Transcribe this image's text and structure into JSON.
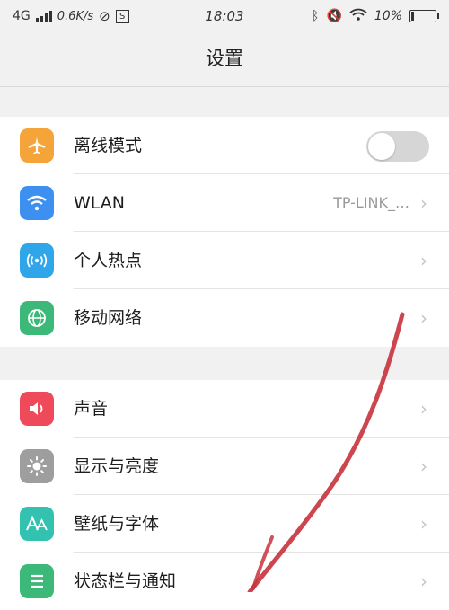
{
  "status_bar": {
    "network": "4G",
    "speed": "0.6K/s",
    "extra_box": "S",
    "time": "18:03",
    "battery": "10%",
    "battery_level": 0.1,
    "icons": [
      "signal-icon",
      "sync-icon",
      "bluetooth-icon",
      "mute-icon",
      "wifi-icon",
      "battery-icon"
    ]
  },
  "header": {
    "title": "设置"
  },
  "groups": [
    {
      "items": [
        {
          "label": "离线模式",
          "icon": "airplane-icon",
          "icon_color": "#f5a43a",
          "toggle": "off"
        },
        {
          "label": "WLAN",
          "icon": "wifi-icon",
          "icon_color": "#3d8ff0",
          "value": "TP-LINK_…"
        },
        {
          "label": "个人热点",
          "icon": "hotspot-icon",
          "icon_color": "#2fa6ea"
        },
        {
          "label": "移动网络",
          "icon": "globe-icon",
          "icon_color": "#3cb978"
        }
      ]
    },
    {
      "items": [
        {
          "label": "声音",
          "icon": "speaker-icon",
          "icon_color": "#ee4a5a"
        },
        {
          "label": "显示与亮度",
          "icon": "brightness-icon",
          "icon_color": "#9e9e9e"
        },
        {
          "label": "壁纸与字体",
          "icon": "font-icon",
          "icon_color": "#33c1b0"
        },
        {
          "label": "状态栏与通知",
          "icon": "notification-icon",
          "icon_color": "#3cb978"
        }
      ]
    }
  ],
  "annotation": {
    "color": "#c8323c"
  }
}
